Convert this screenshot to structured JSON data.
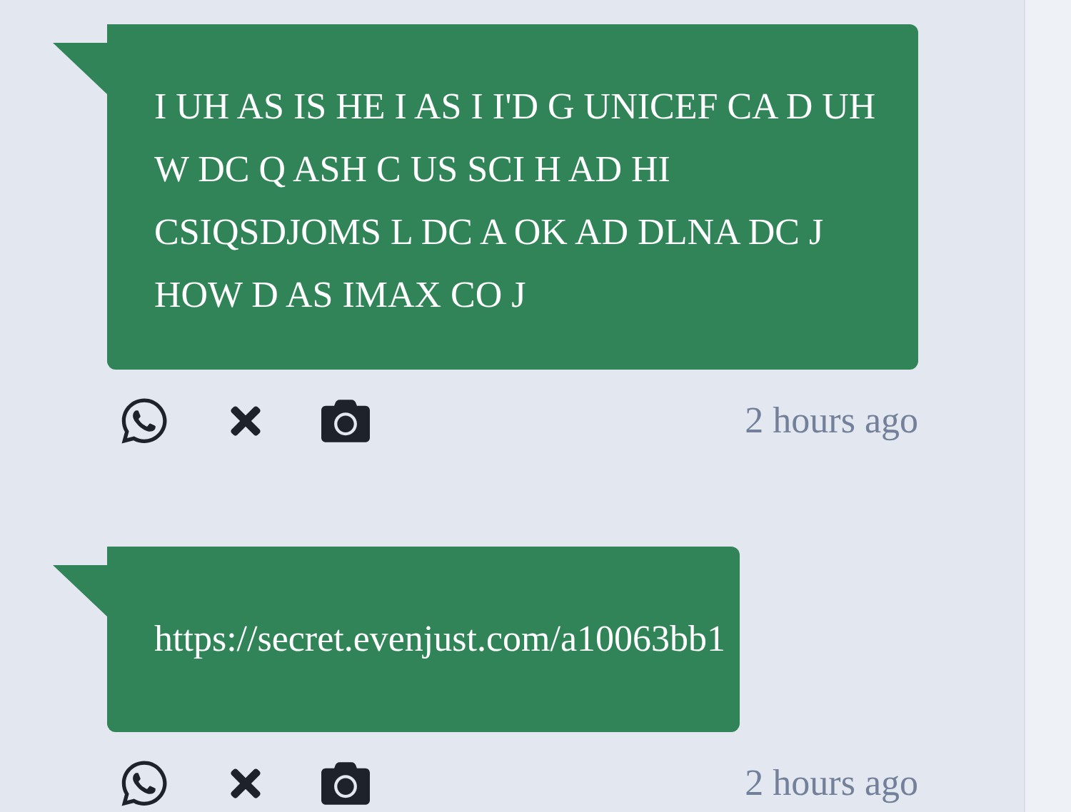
{
  "messages": [
    {
      "text": "I UH AS IS HE I AS I I'D G UNICEF CA D UH W DC Q ASH C US SCI H AD HI CSIQSDJOMS L DC A OK AD DLNA DC J HOW D AS IMAX CO J",
      "time": "2 hours ago"
    },
    {
      "text": "https://secret.evenjust.com/a10063bb1",
      "time": "2 hours ago"
    }
  ]
}
